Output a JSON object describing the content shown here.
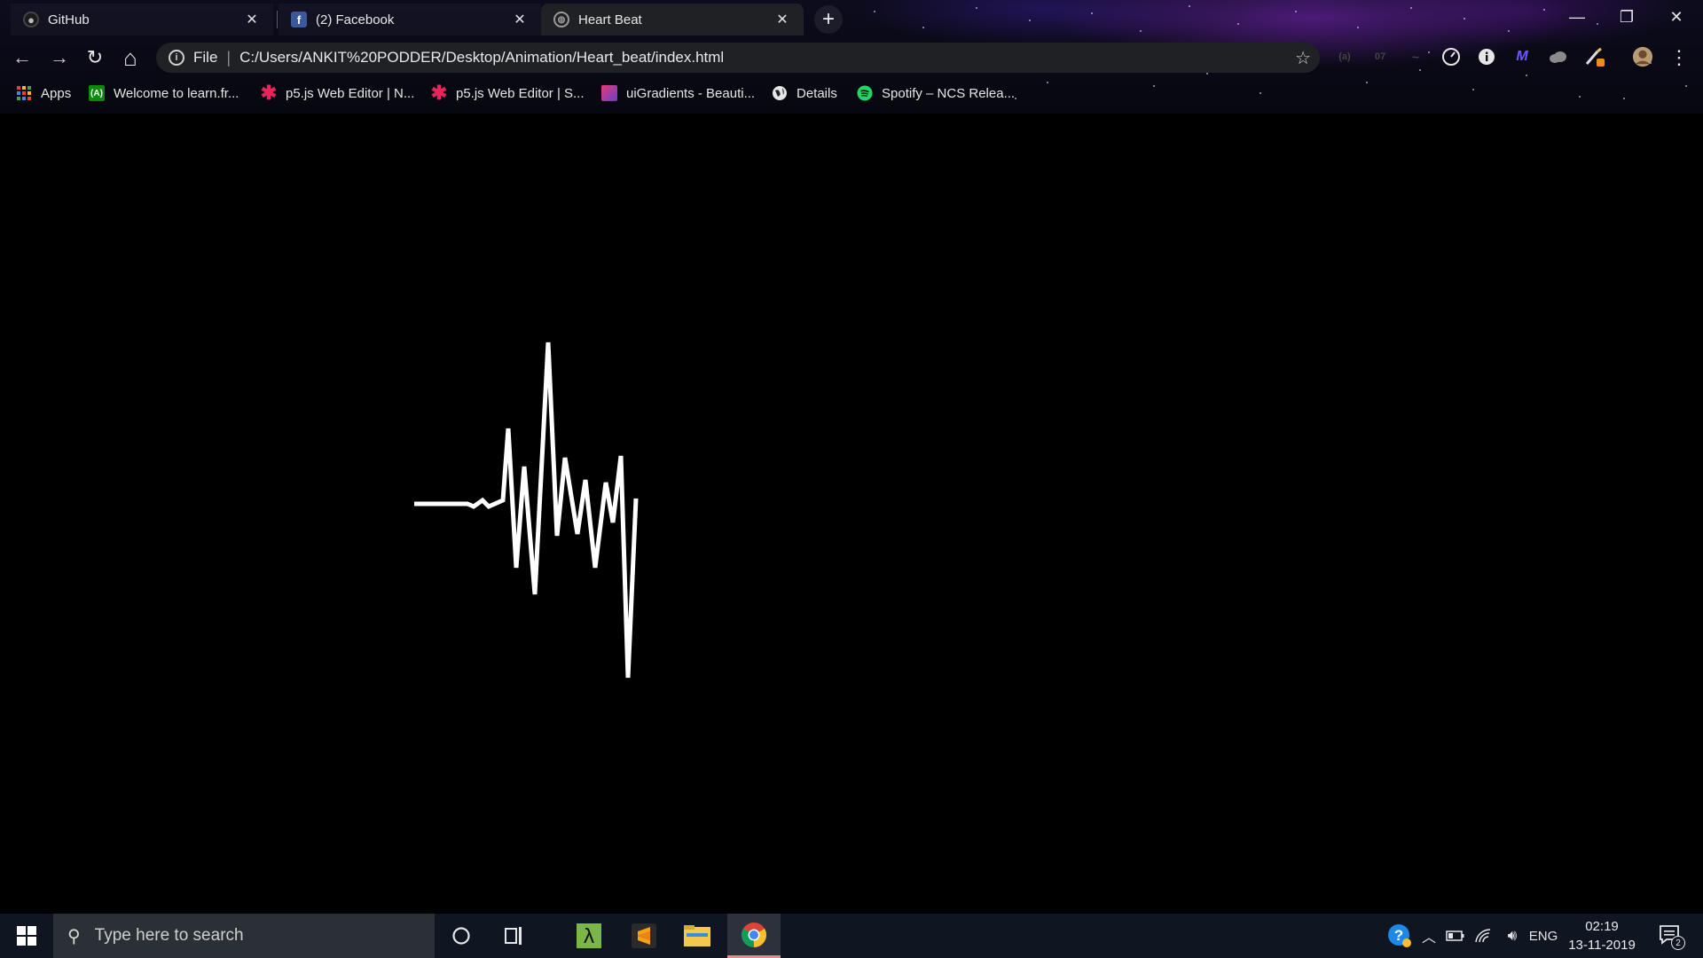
{
  "browser": {
    "tabs": [
      {
        "title": "GitHub",
        "favicon": "github-icon",
        "active": false
      },
      {
        "title": "(2) Facebook",
        "favicon": "facebook-icon",
        "active": false
      },
      {
        "title": "Heart Beat",
        "favicon": "globe-icon",
        "active": true
      }
    ],
    "new_tab_label": "+",
    "window_controls": {
      "minimize": "—",
      "restore": "❐",
      "close": "✕"
    },
    "toolbar": {
      "back": "←",
      "forward": "→",
      "reload": "↻",
      "home": "⌂",
      "scheme": "File",
      "url": "C:/Users/ANKIT%20PODDER/Desktop/Animation/Heart_beat/index.html",
      "bookmark_star": "☆",
      "menu": "⋮"
    },
    "bookmarks": [
      {
        "label": "Apps",
        "icon": "apps-grid-icon"
      },
      {
        "label": "Welcome to learn.fr...",
        "icon": "learn-icon"
      },
      {
        "label": "p5.js Web Editor | N...",
        "icon": "p5js-asterisk-icon"
      },
      {
        "label": "p5.js Web Editor | S...",
        "icon": "p5js-asterisk-icon"
      },
      {
        "label": "uiGradients - Beauti...",
        "icon": "uigradients-icon"
      },
      {
        "label": "Details",
        "icon": "globe-icon"
      },
      {
        "label": "Spotify – NCS Relea...",
        "icon": "spotify-icon"
      }
    ]
  },
  "page": {
    "title": "Heart Beat",
    "heartbeat": {
      "line_color": "#ffffff",
      "background": "#000000",
      "points": [
        [
          0,
          0
        ],
        [
          60,
          0
        ],
        [
          67,
          3
        ],
        [
          77,
          -4
        ],
        [
          84,
          3
        ],
        [
          100,
          -4
        ],
        [
          106,
          -85
        ],
        [
          115,
          72
        ],
        [
          124,
          -42
        ],
        [
          136,
          102
        ],
        [
          151,
          -182
        ],
        [
          161,
          36
        ],
        [
          170,
          -52
        ],
        [
          184,
          34
        ],
        [
          193,
          -27
        ],
        [
          204,
          72
        ],
        [
          216,
          -24
        ],
        [
          224,
          21
        ],
        [
          233,
          -54
        ],
        [
          241,
          196
        ],
        [
          250,
          -6
        ]
      ]
    }
  },
  "taskbar": {
    "search_placeholder": "Type here to search",
    "tray": {
      "language": "ENG",
      "time": "02:19",
      "date": "13-11-2019",
      "notification_count": "2"
    }
  },
  "colors": {
    "tab_active": "#202124",
    "omnibox": "#202124",
    "taskbar": "#101522",
    "accent": "#8a2be2"
  }
}
